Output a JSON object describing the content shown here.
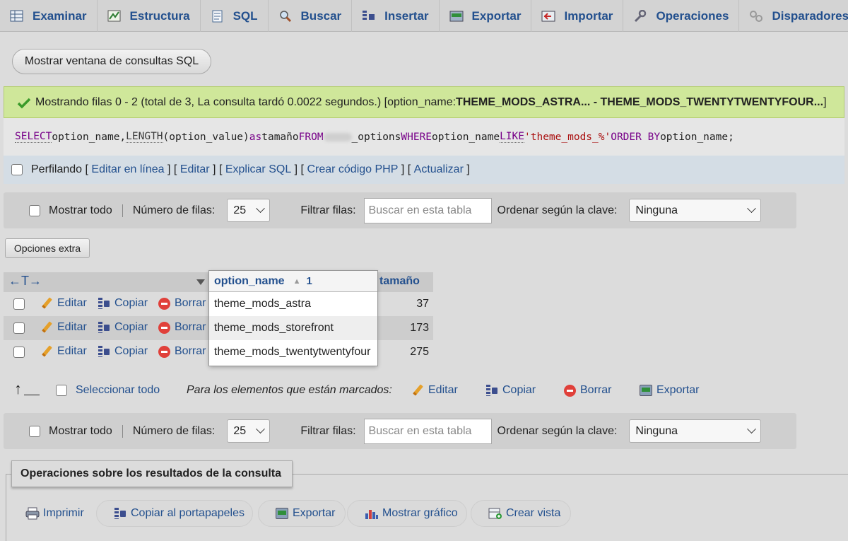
{
  "tabs": [
    {
      "label": "Examinar",
      "icon": "browse-icon"
    },
    {
      "label": "Estructura",
      "icon": "structure-icon"
    },
    {
      "label": "SQL",
      "icon": "sql-icon"
    },
    {
      "label": "Buscar",
      "icon": "search-icon"
    },
    {
      "label": "Insertar",
      "icon": "insert-icon"
    },
    {
      "label": "Exportar",
      "icon": "export-icon"
    },
    {
      "label": "Importar",
      "icon": "import-icon"
    },
    {
      "label": "Operaciones",
      "icon": "wrench-icon"
    },
    {
      "label": "Disparadores",
      "icon": "triggers-icon"
    }
  ],
  "show_query_window": "Mostrar ventana de consultas SQL",
  "message": {
    "prefix": "Mostrando filas 0 - 2 (total de 3, La consulta tardó 0.0022 segundos.) [option_name: ",
    "range": "THEME_MODS_ASTRA... - THEME_MODS_TWENTYTWENTYFOUR...",
    "suffix": "]"
  },
  "sql": {
    "select": "SELECT",
    "col1": " option_name, ",
    "length": "LENGTH",
    "arg": "(option_value) ",
    "as": "as",
    "alias": " tamaño ",
    "from": "FROM",
    "table": "_options ",
    "where": "WHERE",
    "col2": " option_name ",
    "like": "LIKE",
    "pattern": " 'theme_mods_%' ",
    "order": "ORDER BY",
    "col3": " option_name;"
  },
  "profiling": {
    "label": "Perfilando",
    "bracket_open": " [ ",
    "sep": " ] [ ",
    "bracket_close": " ]",
    "links": [
      "Editar en línea",
      "Editar",
      "Explicar SQL",
      "Crear código PHP",
      "Actualizar"
    ]
  },
  "nav": {
    "show_all": "Mostrar todo",
    "rows_label": "Número de filas:",
    "rows_value": "25",
    "filter_label": "Filtrar filas:",
    "filter_placeholder": "Buscar en esta tabla",
    "sort_label": "Ordenar según la clave:",
    "sort_value": "Ninguna"
  },
  "extra_options": "Opciones extra",
  "table": {
    "arrows": "←T→",
    "columns": [
      "option_name",
      "tamaño"
    ],
    "sort_index": "1",
    "sort_glyph": "▲",
    "rows": [
      {
        "option_name": "theme_mods_astra",
        "size": "37"
      },
      {
        "option_name": "theme_mods_storefront",
        "size": "173"
      },
      {
        "option_name": "theme_mods_twentytwentyfour",
        "size": "275"
      }
    ],
    "actions": {
      "edit": "Editar",
      "copy": "Copiar",
      "delete": "Borrar"
    }
  },
  "mass": {
    "arrow": "↑",
    "select_all": "Seleccionar todo",
    "marked_label": "Para los elementos que están marcados:",
    "edit": "Editar",
    "copy": "Copiar",
    "delete": "Borrar",
    "export": "Exportar"
  },
  "operations": {
    "legend": "Operaciones sobre los resultados de la consulta",
    "print": "Imprimir",
    "copy_clipboard": "Copiar al portapapeles",
    "export": "Exportar",
    "chart": "Mostrar gráfico",
    "create_view": "Crear vista"
  },
  "colors": {
    "link": "#23508e",
    "success_bg": "#cfe79a",
    "keyword": "#770088",
    "string": "#aa1111"
  }
}
